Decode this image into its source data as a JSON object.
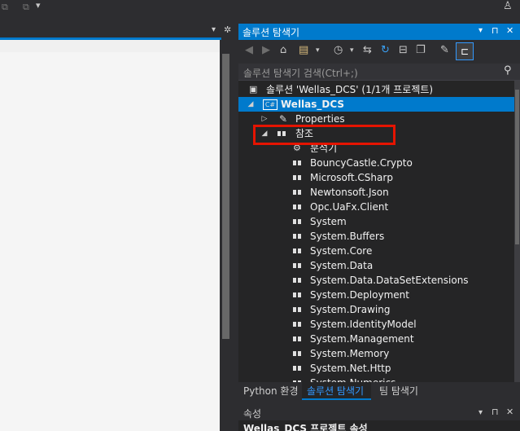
{
  "solution_explorer": {
    "title": "솔루션 탐색기",
    "title_buttons": [
      "▾",
      "⊓",
      "✕"
    ],
    "search_placeholder": "솔루션 탐색기 검색(Ctrl+;)",
    "solution_label": "솔루션 'Wellas_DCS' (1/1개 프로젝트)",
    "project_label": "Wellas_DCS",
    "properties_label": "Properties",
    "references_label": "참조",
    "analyzer_label": "분석기",
    "references": [
      "BouncyCastle.Crypto",
      "Microsoft.CSharp",
      "Newtonsoft.Json",
      "Opc.UaFx.Client",
      "System",
      "System.Buffers",
      "System.Core",
      "System.Data",
      "System.Data.DataSetExtensions",
      "System.Deployment",
      "System.Drawing",
      "System.IdentityModel",
      "System.Management",
      "System.Memory",
      "System.Net.Http",
      "System.Numerics"
    ]
  },
  "tabs": {
    "python": "Python 환경",
    "solution": "솔루션 탐색기",
    "team": "팀 탐색기"
  },
  "properties": {
    "title": "속성",
    "subtitle": "Wellas_DCS 프로젝트 속성"
  },
  "colors": {
    "accent": "#007acc",
    "highlight": "#e51400"
  }
}
